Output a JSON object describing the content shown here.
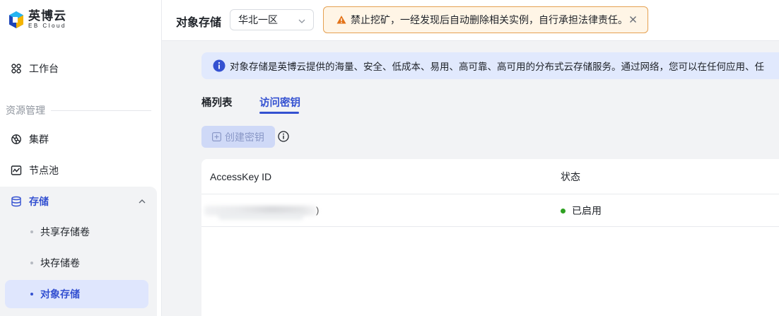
{
  "brand": {
    "name_cn": "英博云",
    "name_en": "EB Cloud"
  },
  "sidebar": {
    "workbench": "工作台",
    "section_resources": "资源管理",
    "items": [
      {
        "label": "集群",
        "icon": "cluster-icon"
      },
      {
        "label": "节点池",
        "icon": "nodepool-icon"
      }
    ],
    "storage": {
      "label": "存储",
      "icon": "database-icon",
      "children": [
        {
          "label": "共享存储卷"
        },
        {
          "label": "块存储卷"
        },
        {
          "label": "对象存储",
          "active": true
        }
      ]
    }
  },
  "header": {
    "title": "对象存储",
    "region": "华北一区",
    "warning": "禁止挖矿，一经发现后自动删除相关实例，自行承担法律责任。"
  },
  "main": {
    "info": "对象存储是英博云提供的海量、安全、低成本、易用、高可靠、高可用的分布式云存储服务。通过网络，您可以在任何应用、任",
    "tabs": [
      {
        "label": "桶列表",
        "active": false
      },
      {
        "label": "访问密钥",
        "active": true
      }
    ],
    "create_button": "创建密钥",
    "table": {
      "columns": [
        "AccessKey ID",
        "状态"
      ],
      "rows": [
        {
          "key_suffix": ")",
          "status": "已启用",
          "status_color": "#2ea121"
        }
      ]
    }
  },
  "colors": {
    "accent": "#3451d1",
    "warning_border": "#e5a152",
    "info_bg": "#e1e9fd"
  }
}
